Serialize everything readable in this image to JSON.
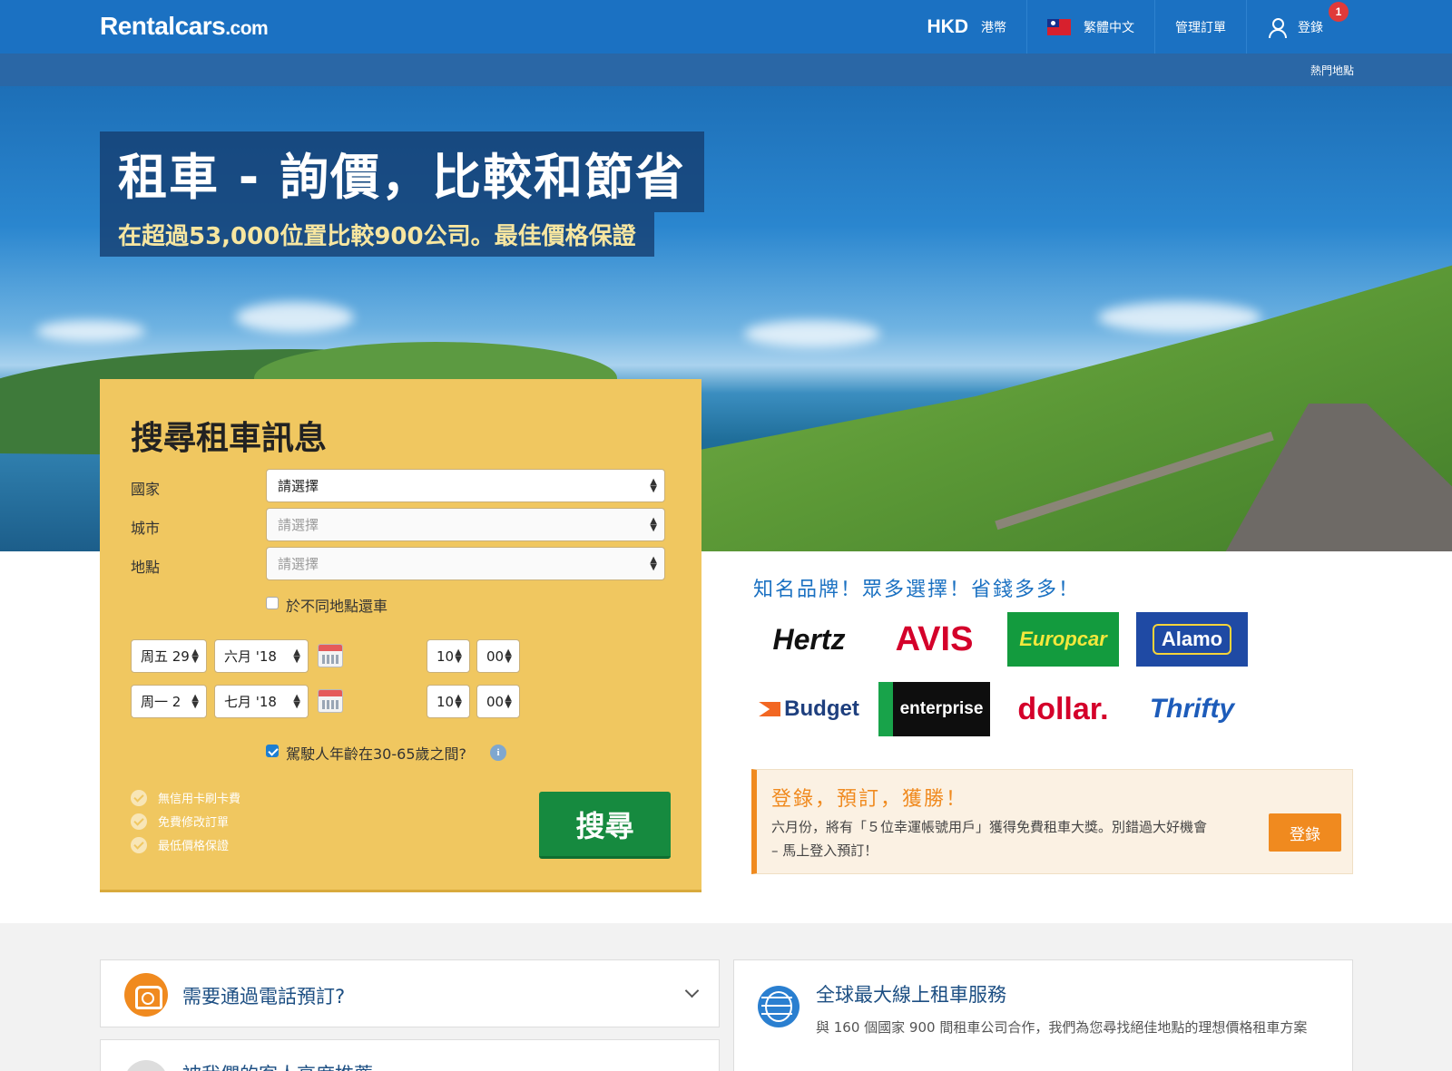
{
  "header": {
    "logo_main": "Rentalcars",
    "logo_tld": ".com",
    "currency_code": "HKD",
    "currency_name": "港幣",
    "language": "繁體中文",
    "manage_booking": "管理訂單",
    "login": "登錄",
    "notification_count": "1",
    "popular_places": "熱門地點"
  },
  "hero": {
    "title": "租車 - 詢價，比較和節省",
    "subtitle": "在超過53,000位置比較900公司。最佳價格保證"
  },
  "search": {
    "heading": "搜尋租車訊息",
    "country_label": "國家",
    "country_value": "請選擇",
    "city_label": "城市",
    "city_value": "請選擇",
    "location_label": "地點",
    "location_value": "請選擇",
    "different_return": "於不同地點還車",
    "pickup": {
      "day": "周五 29",
      "month": "六月 '18",
      "hour": "10",
      "minute": "00"
    },
    "dropoff": {
      "day": "周一 2",
      "month": "七月 '18",
      "hour": "10",
      "minute": "00"
    },
    "age_check": "駕駛人年齡在30-65歲之間?",
    "perks": [
      "無信用卡刷卡費",
      "免費修改訂單",
      "最低價格保證"
    ],
    "button": "搜尋"
  },
  "brands": {
    "title": "知名品牌！眾多選擇！省錢多多！",
    "names": [
      "Hertz",
      "AVIS",
      "Europcar",
      "Alamo",
      "Budget",
      "enterprise",
      "dollar.",
      "Thrifty"
    ]
  },
  "promo": {
    "title": "登錄，預訂，獲勝！",
    "text": "六月份，將有「５位幸運帳號用戶」獲得免費租車大獎。別錯過大好機會 – 馬上登入預訂！",
    "button": "登錄"
  },
  "cards": {
    "phone_title": "需要通過電話預訂?",
    "recommend_title": "被我們的客人高度推薦",
    "global_title": "全球最大線上租車服務",
    "global_desc": "與 160 個國家 900 間租車公司合作，我們為您尋找絕佳地點的理想價格租車方案"
  }
}
